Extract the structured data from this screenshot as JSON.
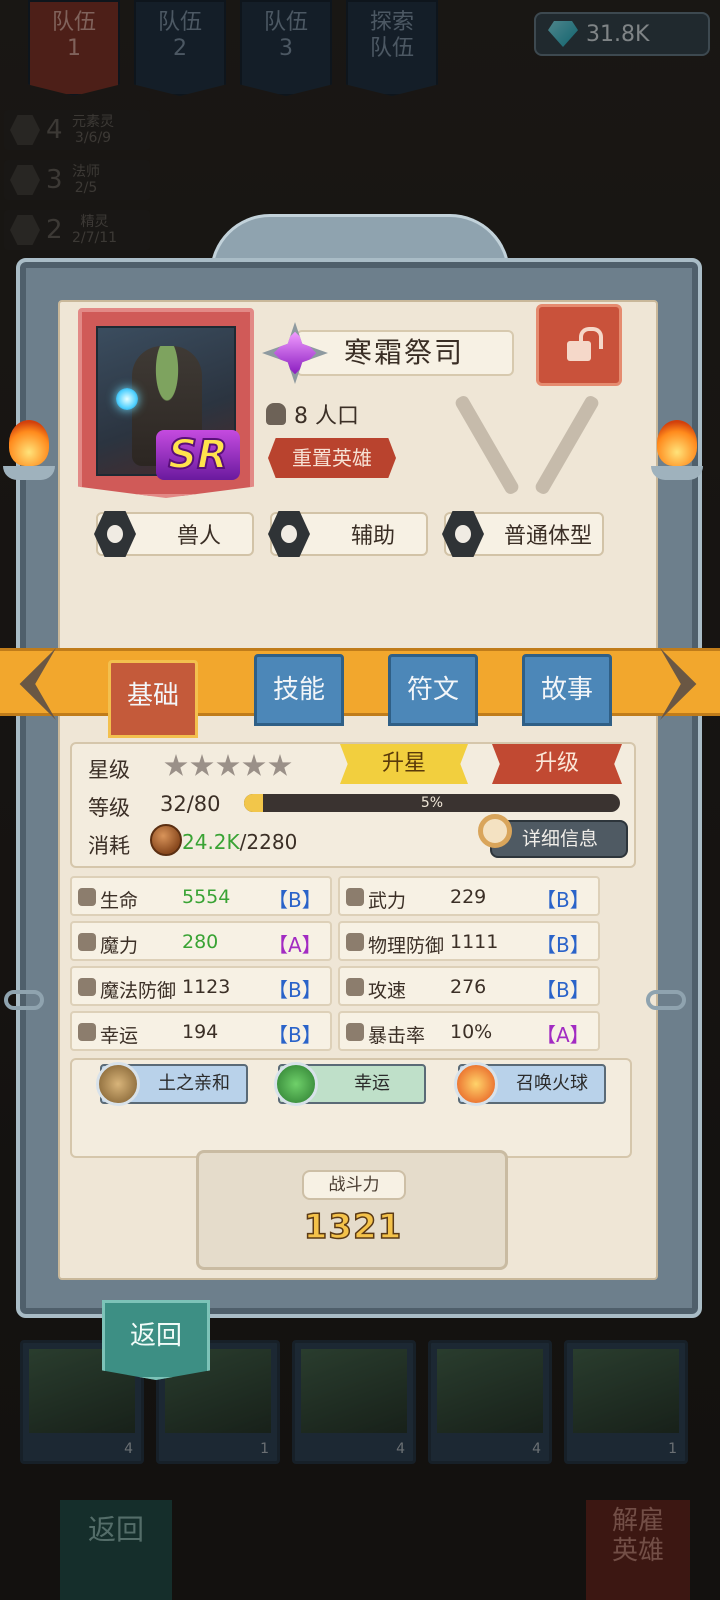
{
  "header": {
    "team_tabs": [
      {
        "line1": "队伍",
        "line2": "1",
        "active": true
      },
      {
        "line1": "队伍",
        "line2": "2",
        "active": false
      },
      {
        "line1": "队伍",
        "line2": "3",
        "active": false
      },
      {
        "line1": "探索",
        "line2": "队伍",
        "active": false
      }
    ],
    "gems": "31.8K"
  },
  "bonds": [
    {
      "count": "4",
      "name": "元素灵",
      "progress": "3/6/9"
    },
    {
      "count": "3",
      "name": "法师",
      "progress": "2/5"
    },
    {
      "count": "2",
      "name": "精灵",
      "progress": "2/7/11"
    }
  ],
  "hero": {
    "rarity": "SR",
    "name": "寒霜祭司",
    "population": "8 人口",
    "reset_label": "重置英雄",
    "tags": [
      "兽人",
      "辅助",
      "普通体型"
    ]
  },
  "tabs": [
    "基础",
    "技能",
    "符文",
    "故事"
  ],
  "basic": {
    "star_label": "星级",
    "stars_filled": 0,
    "stars_total": 5,
    "upgrade_star": "升星",
    "upgrade_level": "升级",
    "level_label": "等级",
    "level_value": "32/80",
    "level_progress": "5%",
    "level_fraction": 0.05,
    "cost_label": "消耗",
    "cost_current": "24.2K",
    "cost_required": "/2280",
    "details_button": "详细信息"
  },
  "attributes": [
    {
      "name": "生命",
      "value": "5554",
      "grade": "【B】",
      "highlight": true
    },
    {
      "name": "武力",
      "value": "229",
      "grade": "【B】",
      "highlight": false
    },
    {
      "name": "魔力",
      "value": "280",
      "grade": "【A】",
      "highlight": true
    },
    {
      "name": "物理防御",
      "value": "1111",
      "grade": "【B】",
      "highlight": false
    },
    {
      "name": "魔法防御",
      "value": "1123",
      "grade": "【B】",
      "highlight": false
    },
    {
      "name": "攻速",
      "value": "276",
      "grade": "【B】",
      "highlight": false
    },
    {
      "name": "幸运",
      "value": "194",
      "grade": "【B】",
      "highlight": false
    },
    {
      "name": "暴击率",
      "value": "10%",
      "grade": "【A】",
      "highlight": false
    }
  ],
  "skills": [
    "土之亲和",
    "幸运",
    "召唤火球"
  ],
  "power": {
    "label": "战斗力",
    "value": "1321"
  },
  "back_label": "返回",
  "roster_levels": [
    "4",
    "1",
    "4",
    "4",
    "1"
  ],
  "bottom": {
    "back": "返回",
    "dismiss_line1": "解雇",
    "dismiss_line2": "英雄"
  },
  "colors": {
    "accent_orange": "#f2a72d",
    "rarity_purple": "#8a1dc0",
    "stat_green": "#39a334",
    "grade_blue": "#2a63c9",
    "grade_purple": "#a22bc2"
  }
}
